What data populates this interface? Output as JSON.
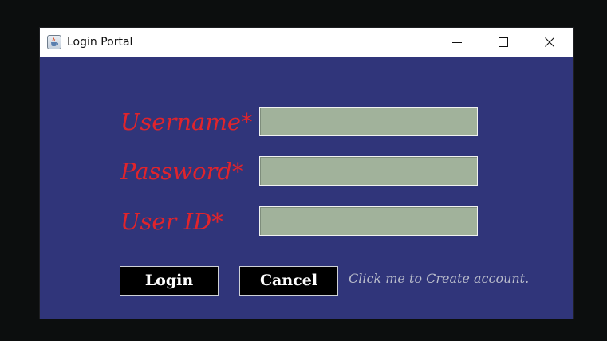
{
  "window": {
    "title": "Login Portal",
    "icon": "java-coffee-cup-icon",
    "controls": [
      "minimize-icon",
      "maximize-icon",
      "close-icon"
    ]
  },
  "form": {
    "username_label": "Username*",
    "username_value": "",
    "password_label": "Password*",
    "password_value": "",
    "userid_label": "User ID*",
    "userid_value": ""
  },
  "actions": {
    "login_label": "Login",
    "cancel_label": "Cancel",
    "create_account_label": "Click me to Create account."
  },
  "colors": {
    "panel_background": "#30357a",
    "label_color": "#e0242c",
    "field_background": "#a1b29b",
    "button_background": "#000000",
    "button_text": "#ffffff",
    "link_text": "#b9bccb"
  }
}
